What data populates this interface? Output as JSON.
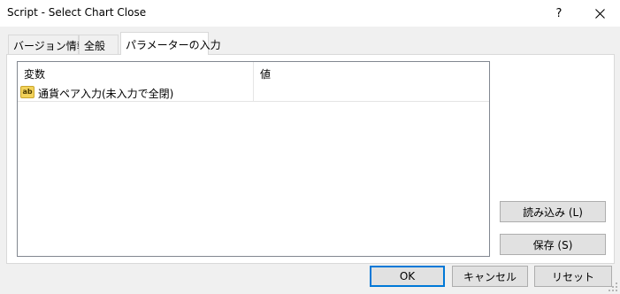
{
  "window": {
    "title": "Script - Select Chart Close",
    "help_glyph": "?"
  },
  "tabs": [
    {
      "label": "バージョン情報"
    },
    {
      "label": "全般"
    },
    {
      "label": "パラメーターの入力"
    }
  ],
  "parameters": {
    "columns": [
      "変数",
      "値"
    ],
    "rows": [
      {
        "icon": "ab",
        "name": "通貨ペア入力(未入力で全閉)",
        "value": ""
      }
    ]
  },
  "side_buttons": {
    "load": "読み込み (L)",
    "save": "保存 (S)"
  },
  "footer_buttons": {
    "ok": "OK",
    "cancel": "キャンセル",
    "reset": "リセット"
  }
}
